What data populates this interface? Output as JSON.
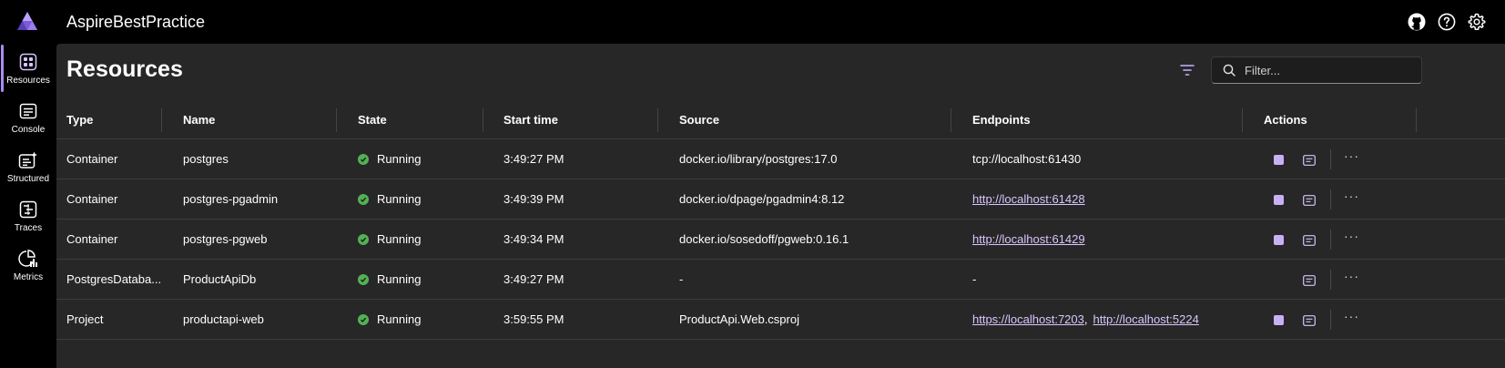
{
  "app": {
    "title": "AspireBestPractice"
  },
  "nav": {
    "items": [
      {
        "label": "Resources",
        "icon": "resources-icon",
        "active": true
      },
      {
        "label": "Console",
        "icon": "console-icon",
        "active": false
      },
      {
        "label": "Structured",
        "icon": "structured-icon",
        "active": false
      },
      {
        "label": "Traces",
        "icon": "traces-icon",
        "active": false
      },
      {
        "label": "Metrics",
        "icon": "metrics-icon",
        "active": false
      }
    ]
  },
  "topbar": {
    "icons": [
      "github-icon",
      "help-icon",
      "settings-icon"
    ]
  },
  "page": {
    "title": "Resources"
  },
  "search": {
    "placeholder": "Filter..."
  },
  "colors": {
    "accent": "#a98df5",
    "running": "#54b054",
    "link": "#d9c6ff",
    "panel": "#272727"
  },
  "table": {
    "columns": [
      "Type",
      "Name",
      "State",
      "Start time",
      "Source",
      "Endpoints",
      "Actions"
    ],
    "rows": [
      {
        "type": "Container",
        "name": "postgres",
        "state": "Running",
        "start": "3:49:27 PM",
        "source": "docker.io/library/postgres:17.0",
        "endpoint1": "tcp://localhost:61430",
        "endpoint2": ""
      },
      {
        "type": "Container",
        "name": "postgres-pgadmin",
        "state": "Running",
        "start": "3:49:39 PM",
        "source": "docker.io/dpage/pgadmin4:8.12",
        "endpoint1": "http://localhost:61428",
        "endpoint2": ""
      },
      {
        "type": "Container",
        "name": "postgres-pgweb",
        "state": "Running",
        "start": "3:49:34 PM",
        "source": "docker.io/sosedoff/pgweb:0.16.1",
        "endpoint1": "http://localhost:61429",
        "endpoint2": ""
      },
      {
        "type": "PostgresDataba...",
        "name": "ProductApiDb",
        "state": "Running",
        "start": "3:49:27 PM",
        "source": "-",
        "endpoint1": "-",
        "endpoint2": ""
      },
      {
        "type": "Project",
        "name": "productapi-web",
        "state": "Running",
        "start": "3:59:55 PM",
        "source": "ProductApi.Web.csproj",
        "endpoint1": "https://localhost:7203",
        "endpoint2": "http://localhost:5224"
      }
    ],
    "endpoint_separator": ","
  }
}
